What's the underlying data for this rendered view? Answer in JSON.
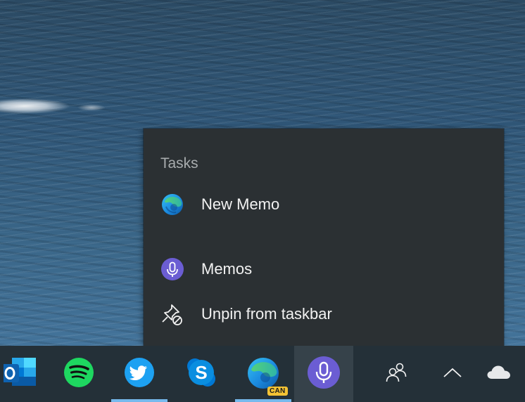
{
  "jump_list": {
    "header": "Tasks",
    "items": [
      {
        "label": "New Memo",
        "icon": "edge-icon"
      },
      {
        "label": "Memos",
        "icon": "microphone-icon"
      },
      {
        "label": "Unpin from taskbar",
        "icon": "unpin-icon"
      }
    ]
  },
  "taskbar": {
    "apps": [
      {
        "name": "Outlook",
        "icon": "outlook-icon",
        "running": false
      },
      {
        "name": "Spotify",
        "icon": "spotify-icon",
        "running": false
      },
      {
        "name": "Twitter",
        "icon": "twitter-icon",
        "running": true
      },
      {
        "name": "Skype",
        "icon": "skype-icon",
        "running": false
      },
      {
        "name": "Microsoft Edge Canary",
        "icon": "edge-canary-icon",
        "badge": "CAN",
        "running": true
      },
      {
        "name": "Memos",
        "icon": "microphone-icon",
        "running": false,
        "active": true
      }
    ],
    "tray": [
      {
        "icon": "people-icon"
      },
      {
        "icon": "chevron-up-icon"
      },
      {
        "icon": "onedrive-cloud-icon"
      }
    ],
    "edge_badge": "CAN"
  },
  "colors": {
    "menu_background": "#2b3033",
    "taskbar_background": "#243038",
    "taskbar_active": "#36424a",
    "running_indicator": "#76b9ed",
    "memos_purple": "#6b5dd3",
    "twitter_blue": "#1da1f2",
    "spotify_green": "#1ed760",
    "skype_blue": "#0078d4"
  }
}
